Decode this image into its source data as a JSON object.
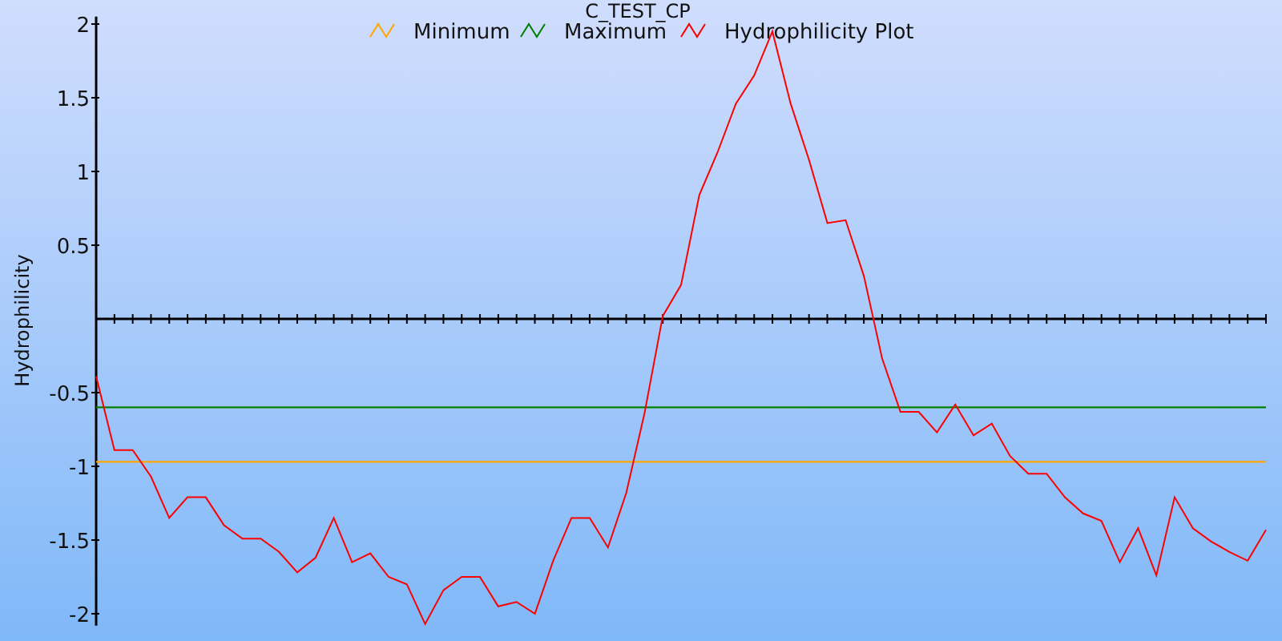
{
  "chart_data": {
    "type": "line",
    "title": "C_TEST_CP",
    "ylabel": "Hydrophilicity",
    "legend": true,
    "ylim": [
      -2.08,
      2.04
    ],
    "yticks": [
      -2,
      -1.5,
      -1,
      -0.5,
      0.5,
      1,
      1.5,
      2
    ],
    "series": [
      {
        "name": "Minimum",
        "color": "#ffa500",
        "values": [
          -0.97,
          -0.97,
          -0.97,
          -0.97,
          -0.97,
          -0.97,
          -0.97,
          -0.97,
          -0.97,
          -0.97,
          -0.97,
          -0.97,
          -0.97,
          -0.97,
          -0.97,
          -0.97,
          -0.97,
          -0.97,
          -0.97,
          -0.97,
          -0.97,
          -0.97,
          -0.97,
          -0.97,
          -0.97,
          -0.97,
          -0.97,
          -0.97,
          -0.97,
          -0.97,
          -0.97,
          -0.97,
          -0.97,
          -0.97,
          -0.97,
          -0.97,
          -0.97,
          -0.97,
          -0.97,
          -0.97,
          -0.97,
          -0.97,
          -0.97,
          -0.97,
          -0.97,
          -0.97,
          -0.97,
          -0.97,
          -0.97,
          -0.97,
          -0.97,
          -0.97,
          -0.97,
          -0.97,
          -0.97,
          -0.97,
          -0.97,
          -0.97,
          -0.97,
          -0.97,
          -0.97,
          -0.97,
          -0.97,
          -0.97,
          -0.97
        ]
      },
      {
        "name": "Maximum",
        "color": "#008000",
        "values": [
          -0.6,
          -0.6,
          -0.6,
          -0.6,
          -0.6,
          -0.6,
          -0.6,
          -0.6,
          -0.6,
          -0.6,
          -0.6,
          -0.6,
          -0.6,
          -0.6,
          -0.6,
          -0.6,
          -0.6,
          -0.6,
          -0.6,
          -0.6,
          -0.6,
          -0.6,
          -0.6,
          -0.6,
          -0.6,
          -0.6,
          -0.6,
          -0.6,
          -0.6,
          -0.6,
          -0.6,
          -0.6,
          -0.6,
          -0.6,
          -0.6,
          -0.6,
          -0.6,
          -0.6,
          -0.6,
          -0.6,
          -0.6,
          -0.6,
          -0.6,
          -0.6,
          -0.6,
          -0.6,
          -0.6,
          -0.6,
          -0.6,
          -0.6,
          -0.6,
          -0.6,
          -0.6,
          -0.6,
          -0.6,
          -0.6,
          -0.6,
          -0.6,
          -0.6,
          -0.6,
          -0.6,
          -0.6,
          -0.6,
          -0.6,
          -0.6
        ]
      },
      {
        "name": "Hydrophilicity Plot",
        "color": "#ff0000",
        "values": [
          -0.39,
          -0.89,
          -0.89,
          -1.07,
          -1.35,
          -1.21,
          -1.21,
          -1.4,
          -1.49,
          -1.49,
          -1.58,
          -1.72,
          -1.62,
          -1.35,
          -1.65,
          -1.59,
          -1.75,
          -1.8,
          -2.07,
          -1.84,
          -1.75,
          -1.75,
          -1.95,
          -1.92,
          -2.0,
          -1.64,
          -1.35,
          -1.35,
          -1.55,
          -1.18,
          -0.64,
          0.02,
          0.23,
          0.84,
          1.13,
          1.46,
          1.65,
          1.95,
          1.46,
          1.08,
          0.65,
          0.67,
          0.29,
          -0.27,
          -0.63,
          -0.63,
          -0.77,
          -0.58,
          -0.79,
          -0.71,
          -0.93,
          -1.05,
          -1.05,
          -1.21,
          -1.32,
          -1.37,
          -1.65,
          -1.42,
          -1.74,
          -1.21,
          -1.42,
          -1.51,
          -1.58,
          -1.64,
          -1.43
        ]
      }
    ]
  }
}
